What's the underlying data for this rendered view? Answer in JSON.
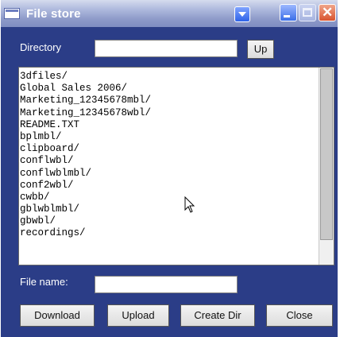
{
  "window": {
    "title": "File store",
    "controls": {
      "menu": "dropdown-arrow-icon",
      "minimize": "minimize-icon",
      "maximize": "maximize-icon",
      "close": "close-icon"
    }
  },
  "directory": {
    "label": "Directory",
    "value": "",
    "up_label": "Up"
  },
  "files": [
    "3dfiles/",
    "Global Sales 2006/",
    "Marketing_12345678mbl/",
    "Marketing_12345678wbl/",
    "README.TXT",
    "bplmbl/",
    "clipboard/",
    "conflwbl/",
    "conflwblmbl/",
    "conf2wbl/",
    "cwbb/",
    "gblwblmbl/",
    "gbwbl/",
    "recordings/"
  ],
  "filename": {
    "label": "File name:",
    "value": ""
  },
  "actions": {
    "download": "Download",
    "upload": "Upload",
    "create_dir": "Create Dir",
    "close": "Close"
  },
  "colors": {
    "window_bg": "#2b3d87",
    "accent": "#2e62e8",
    "close_accent": "#d9542f"
  }
}
